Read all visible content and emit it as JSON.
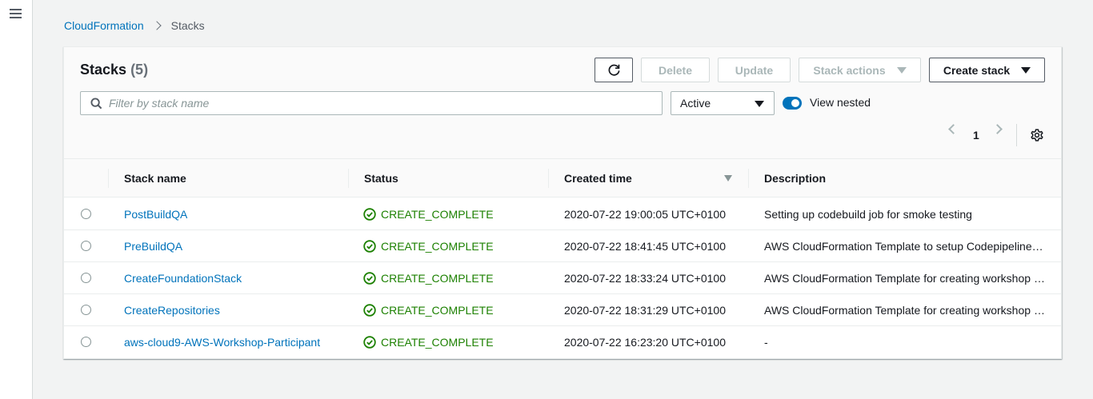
{
  "breadcrumb": {
    "parent": "CloudFormation",
    "current": "Stacks"
  },
  "header": {
    "title": "Stacks",
    "count": "(5)"
  },
  "toolbar": {
    "delete_label": "Delete",
    "update_label": "Update",
    "stack_actions_label": "Stack actions",
    "create_stack_label": "Create stack"
  },
  "filter": {
    "search_placeholder": "Filter by stack name",
    "status_select": "Active",
    "view_nested_label": "View nested",
    "view_nested_on": true
  },
  "pagination": {
    "current_page": "1"
  },
  "table": {
    "columns": [
      "Stack name",
      "Status",
      "Created time",
      "Description"
    ],
    "sorted_column": "Created time",
    "rows": [
      {
        "name": "PostBuildQA",
        "status": "CREATE_COMPLETE",
        "created": "2020-07-22 19:00:05 UTC+0100",
        "description": "Setting up codebuild job for smoke testing"
      },
      {
        "name": "PreBuildQA",
        "status": "CREATE_COMPLETE",
        "created": "2020-07-22 18:41:45 UTC+0100",
        "description": "AWS CloudFormation Template to setup Codepipeline for QA"
      },
      {
        "name": "CreateFoundationStack",
        "status": "CREATE_COMPLETE",
        "created": "2020-07-22 18:33:24 UTC+0100",
        "description": "AWS CloudFormation Template for creating workshop foundation"
      },
      {
        "name": "CreateRepositories",
        "status": "CREATE_COMPLETE",
        "created": "2020-07-22 18:31:29 UTC+0100",
        "description": "AWS CloudFormation Template for creating workshop repositories"
      },
      {
        "name": "aws-cloud9-AWS-Workshop-Participant",
        "status": "CREATE_COMPLETE",
        "created": "2020-07-22 16:23:20 UTC+0100",
        "description": "-"
      }
    ]
  },
  "colors": {
    "link": "#0073bb",
    "success": "#1d8102",
    "toggle": "#0073bb"
  },
  "icons": {
    "menu": "hamburger-icon",
    "refresh": "refresh-icon",
    "search": "search-icon",
    "settings": "gear-icon",
    "status": "check-circle-icon"
  }
}
